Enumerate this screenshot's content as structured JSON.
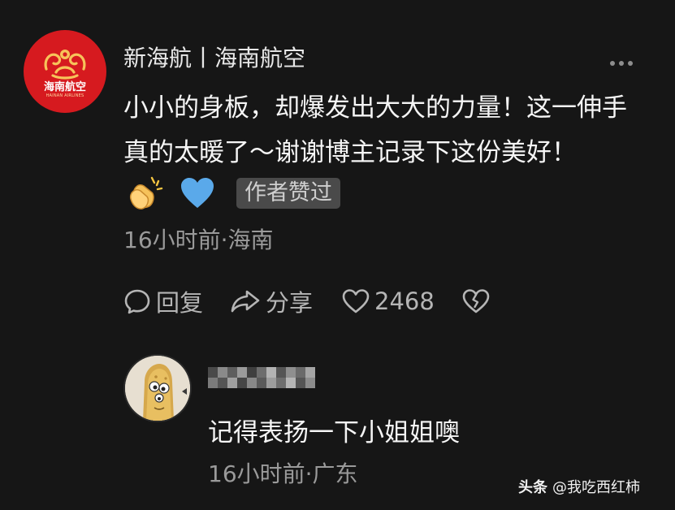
{
  "comment": {
    "author": "新海航丨海南航空",
    "avatar_logo": {
      "cn": "海南航空",
      "en": "HAINAN AIRLINES"
    },
    "text": "小小的身板，却爆发出大大的力量！这一伸手真的太暖了～谢谢博主记录下这份美好！",
    "emojis": [
      "clapping-hands-icon",
      "blue-heart-icon"
    ],
    "author_like_badge": "作者赞过",
    "meta": "16小时前·海南",
    "actions": {
      "reply_label": "回复",
      "share_label": "分享",
      "like_count": "2468"
    }
  },
  "reply": {
    "author": "",
    "text": "记得表扬一下小姐姐噢",
    "meta": "16小时前·广东"
  },
  "watermark": {
    "brand": "头条",
    "handle": "@我吃西红柿"
  },
  "colors": {
    "background": "#161616",
    "badge_bg": "#4a4a4a",
    "logo_red": "#d61a1f",
    "meta_gray": "#9a9a9a"
  }
}
